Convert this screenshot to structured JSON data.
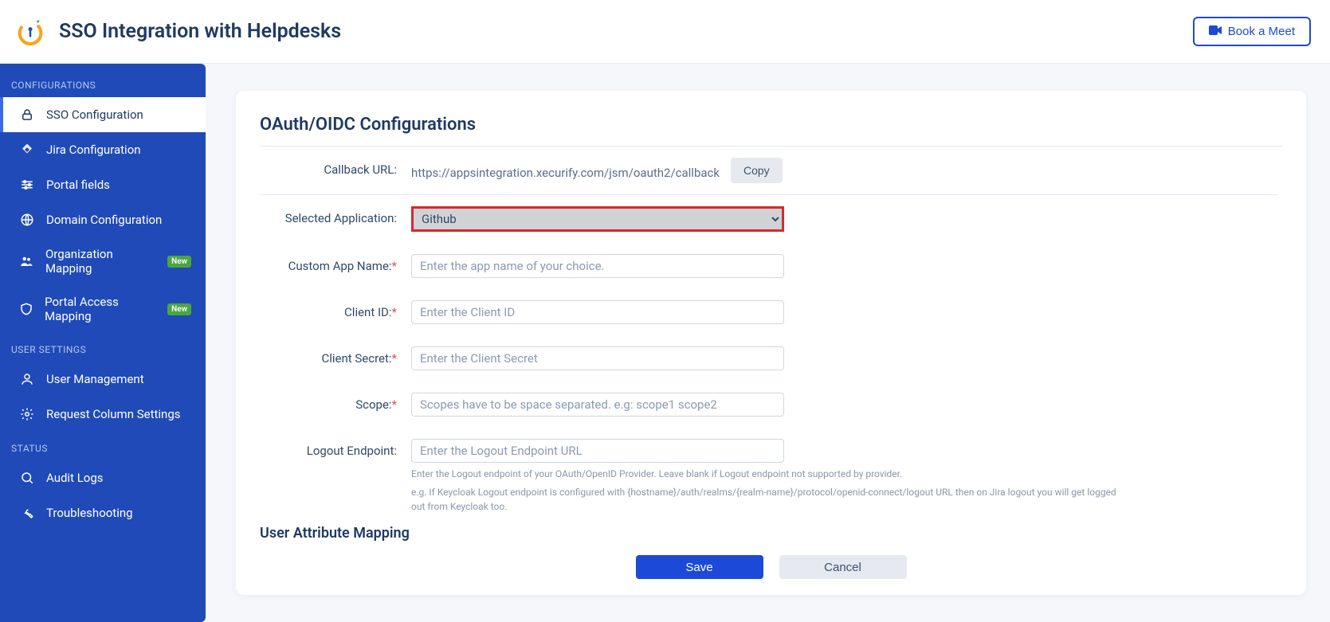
{
  "header": {
    "app_title": "SSO Integration with Helpdesks",
    "book_meet": "Book a Meet"
  },
  "sidebar": {
    "sections": [
      {
        "label": "CONFIGURATIONS",
        "items": [
          {
            "id": "sso",
            "label": "SSO Configuration",
            "active": true
          },
          {
            "id": "jira",
            "label": "Jira Configuration"
          },
          {
            "id": "portal",
            "label": "Portal fields"
          },
          {
            "id": "domain",
            "label": "Domain Configuration"
          },
          {
            "id": "orgmap",
            "label": "Organization Mapping",
            "badge": "New"
          },
          {
            "id": "pam",
            "label": "Portal Access Mapping",
            "badge": "New"
          }
        ]
      },
      {
        "label": "USER SETTINGS",
        "items": [
          {
            "id": "users",
            "label": "User Management"
          },
          {
            "id": "rcs",
            "label": "Request Column Settings"
          }
        ]
      },
      {
        "label": "STATUS",
        "items": [
          {
            "id": "audit",
            "label": "Audit Logs"
          },
          {
            "id": "trouble",
            "label": "Troubleshooting"
          }
        ]
      }
    ]
  },
  "main": {
    "title": "OAuth/OIDC Configurations",
    "callback": {
      "label": "Callback URL:",
      "value": "https://appsintegration.xecurify.com/jsm/oauth2/callback",
      "copy": "Copy"
    },
    "form": {
      "selected_app": {
        "label": "Selected Application:",
        "value": "Github",
        "options": [
          "Github"
        ]
      },
      "custom_name": {
        "label": "Custom App Name:",
        "placeholder": "Enter the app name of your choice.",
        "required": true
      },
      "client_id": {
        "label": "Client ID:",
        "placeholder": "Enter the Client ID",
        "required": true
      },
      "client_secret": {
        "label": "Client Secret:",
        "placeholder": "Enter the Client Secret",
        "required": true
      },
      "scope": {
        "label": "Scope:",
        "placeholder": "Scopes have to be space separated. e.g: scope1 scope2",
        "required": true
      },
      "logout_ep": {
        "label": "Logout Endpoint:",
        "placeholder": "Enter the Logout Endpoint URL",
        "help1": "Enter the Logout endpoint of your OAuth/OpenID Provider. Leave blank if Logout endpoint not supported by provider.",
        "help2": "e.g. If Keycloak Logout endpoint is configured with {hostname}/auth/realms/{realm-name}/protocol/openid-connect/logout URL then on Jira logout you will get logged out from Keycloak too."
      }
    },
    "subheading": "User Attribute Mapping",
    "actions": {
      "save": "Save",
      "cancel": "Cancel"
    }
  }
}
